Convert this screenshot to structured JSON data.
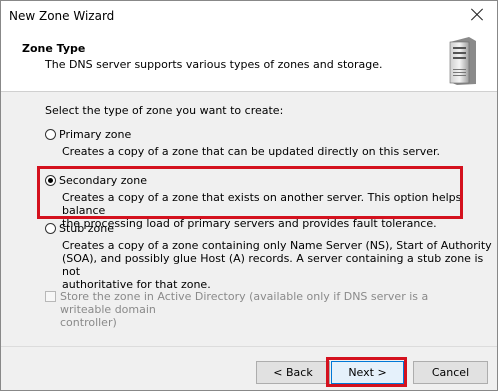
{
  "window": {
    "title": "New Zone Wizard"
  },
  "header": {
    "title": "Zone Type",
    "subtitle": "The DNS server supports various types of zones and storage."
  },
  "content": {
    "prompt": "Select the type of zone you want to create:",
    "options": [
      {
        "label": "Primary zone",
        "selected": false,
        "description": [
          "Creates a copy of a zone that can be updated directly on this server."
        ]
      },
      {
        "label": "Secondary zone",
        "selected": true,
        "description": [
          "Creates a copy of a zone that exists on another server. This option helps balance",
          "the processing load of primary servers and provides fault tolerance."
        ]
      },
      {
        "label": "Stub zone",
        "selected": false,
        "description": [
          "Creates a copy of a zone containing only Name Server (NS), Start of Authority",
          "(SOA), and possibly glue Host (A) records. A server containing a stub zone is not",
          "authoritative for that zone."
        ]
      }
    ],
    "ad_checkbox": {
      "label_line1": "Store the zone in Active Directory (available only if DNS server is a writeable domain",
      "label_line2": "controller)",
      "checked": false,
      "enabled": false
    }
  },
  "buttons": {
    "back": "< Back",
    "next": "Next >",
    "cancel": "Cancel"
  },
  "colors": {
    "highlight": "#d4111e",
    "default_button_border": "#0078d7"
  },
  "icons": {
    "header": "server-icon",
    "close": "close-icon"
  }
}
